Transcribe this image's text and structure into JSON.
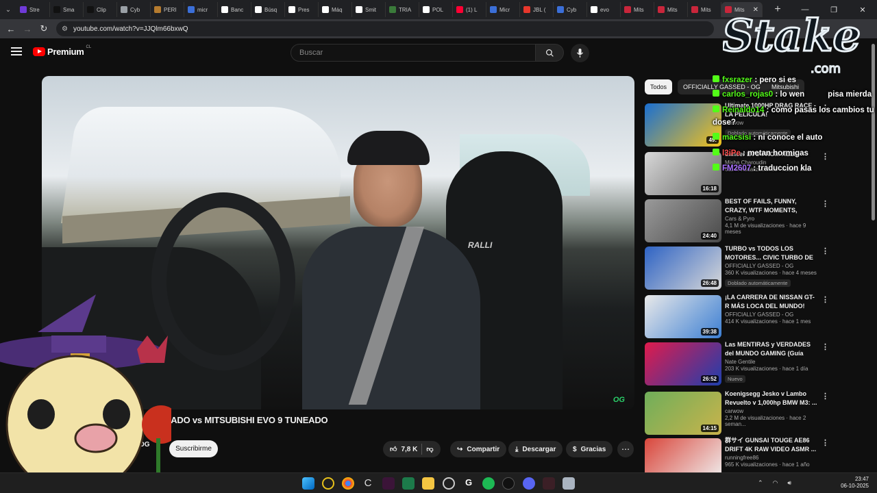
{
  "browser": {
    "tabs": [
      {
        "label": "Stre",
        "color": "#6f3ad8"
      },
      {
        "label": "Sma",
        "color": "#111111"
      },
      {
        "label": "Clip",
        "color": "#111111"
      },
      {
        "label": "Cyb",
        "color": "#9aa0a6"
      },
      {
        "label": "PERI",
        "color": "#b57b2f"
      },
      {
        "label": "micr",
        "color": "#3b6fd8"
      },
      {
        "label": "Banc",
        "color": "#ffffff"
      },
      {
        "label": "Búsq",
        "color": "#ffffff"
      },
      {
        "label": "Pres",
        "color": "#ffffff"
      },
      {
        "label": "Máq",
        "color": "#ffffff"
      },
      {
        "label": "Smit",
        "color": "#ffffff"
      },
      {
        "label": "TRIA",
        "color": "#3a7a3a"
      },
      {
        "label": "POL",
        "color": "#ffffff"
      },
      {
        "label": "(1) L",
        "color": "#ff0033"
      },
      {
        "label": "Micr",
        "color": "#3b6fd8"
      },
      {
        "label": "JBL (",
        "color": "#e8372c"
      },
      {
        "label": "Cyb",
        "color": "#3b6fd8"
      },
      {
        "label": "evo",
        "color": "#ffffff"
      },
      {
        "label": "Mits",
        "color": "#c9263b"
      },
      {
        "label": "Mits",
        "color": "#c9263b"
      },
      {
        "label": "Mits",
        "color": "#c9263b"
      },
      {
        "label": "Mits",
        "color": "#c9263b"
      }
    ],
    "url": "youtube.com/watch?v=JJQlm66bxwQ"
  },
  "youtube": {
    "logo_text": "Premium",
    "region": "CL",
    "search_placeholder": "Buscar"
  },
  "video": {
    "title": "B      TUNEADO vs MITSUBISHI EVO 9 TUNEADO",
    "channel_partial": "OG",
    "subscribe": "Suscribirme",
    "likes": "7,8 K",
    "share": "Compartir",
    "download": "Descargar",
    "thanks": "Gracias",
    "watermark": "OG",
    "interior_badge": "RALLI"
  },
  "chips": [
    "Todos",
    "OFFICIALLY GASSED - OG",
    "Mitsubishi"
  ],
  "recommendations": [
    {
      "title": "Ultimate 1000HP DRAG RACE - LA PELÍCULA!",
      "channel": "carwow",
      "meta": "",
      "badge": "Doblado automáticamente",
      "duration": "49:",
      "thumb_a": "#1a6fd1",
      "thumb_b": "#f4c21b"
    },
    {
      "title": "Lancer EVO FROM HELL",
      "channel": "Misha Charoudin",
      "meta": "611 K visualizaciones · hace 1 mes",
      "badge": "",
      "duration": "16:18",
      "thumb_a": "#d8d8d8",
      "thumb_b": "#6a6a6a"
    },
    {
      "title": "BEST OF FAILS, FUNNY, CRAZY, WTF MOMENTS, CLOSE CALL...",
      "channel": "Cars & Pyro",
      "meta": "4,1 M de visualizaciones · hace 9 meses",
      "badge": "",
      "duration": "24:40",
      "thumb_a": "#9a9a9a",
      "thumb_b": "#4a4a4a"
    },
    {
      "title": "TURBO vs TODOS LOS MOTORES... CIVIC TURBO DE ...",
      "channel": "OFFICIALLY GASSED - OG",
      "meta": "360 K visualizaciones · hace 4 meses",
      "badge": "Doblado automáticamente",
      "duration": "26:48",
      "thumb_a": "#2e63c4",
      "thumb_b": "#d8d8d8"
    },
    {
      "title": "¡LA CARRERA DE NISSAN GT-R MÁS LOCA DEL MUNDO!",
      "channel": "OFFICIALLY GASSED - OG",
      "meta": "414 K visualizaciones · hace 1 mes",
      "badge": "",
      "duration": "39:38",
      "thumb_a": "#e9e9e9",
      "thumb_b": "#3c7fd3"
    },
    {
      "title": "Las MENTIRAS y VERDADES del MUNDO GAMING (Guía Anti-...",
      "channel": "Nate Gentile",
      "meta": "203 K visualizaciones · hace 1 día",
      "badge": "Nuevo",
      "duration": "26:52",
      "thumb_a": "#e01b4c",
      "thumb_b": "#1e3fae"
    },
    {
      "title": "Koenigsegg Jesko v Lambo Revuelto v 1,000hp BMW M3: ...",
      "channel": "carwow",
      "meta": "2,2 M de visualizaciones · hace 2 seman...",
      "badge": "",
      "duration": "14:15",
      "thumb_a": "#6fae5a",
      "thumb_b": "#c9b34b"
    },
    {
      "title": "群サイ GUNSAI TOUGE AE86 DRIFT 4K RAW VIDEO ASMR ...",
      "channel": "runningfree86",
      "meta": "965 K visualizaciones · hace 1 año",
      "badge": "",
      "duration": "",
      "thumb_a": "#d9463b",
      "thumb_b": "#f0f0f0"
    }
  ],
  "chat": [
    {
      "user": "fxsrazer",
      "text": " : pero si es",
      "color": "#53fc18"
    },
    {
      "user": "carlos_rojas0",
      "text": " : lo wen",
      "color": "#53fc18",
      "extra": "pisa mierda"
    },
    {
      "user": "Reinaldo14",
      "text": " : como pasas los cambios tu",
      "color": "#53fc18"
    },
    {
      "user": "",
      "text": "dose?",
      "color": "#ffffff"
    },
    {
      "user": "macsisi",
      "text": " : ni conoce el auto",
      "color": "#53fc18"
    },
    {
      "user": "l3iPe",
      "text": " : metan hormigas",
      "color": "#ff4d4d"
    },
    {
      "user": "FM2607",
      "text": " : traduccion kla",
      "color": "#a970ff"
    }
  ],
  "overlay": {
    "brand": "Stake",
    "domain": ".com"
  },
  "taskbar": {
    "time": "23:47",
    "date": "06-10-2025"
  }
}
